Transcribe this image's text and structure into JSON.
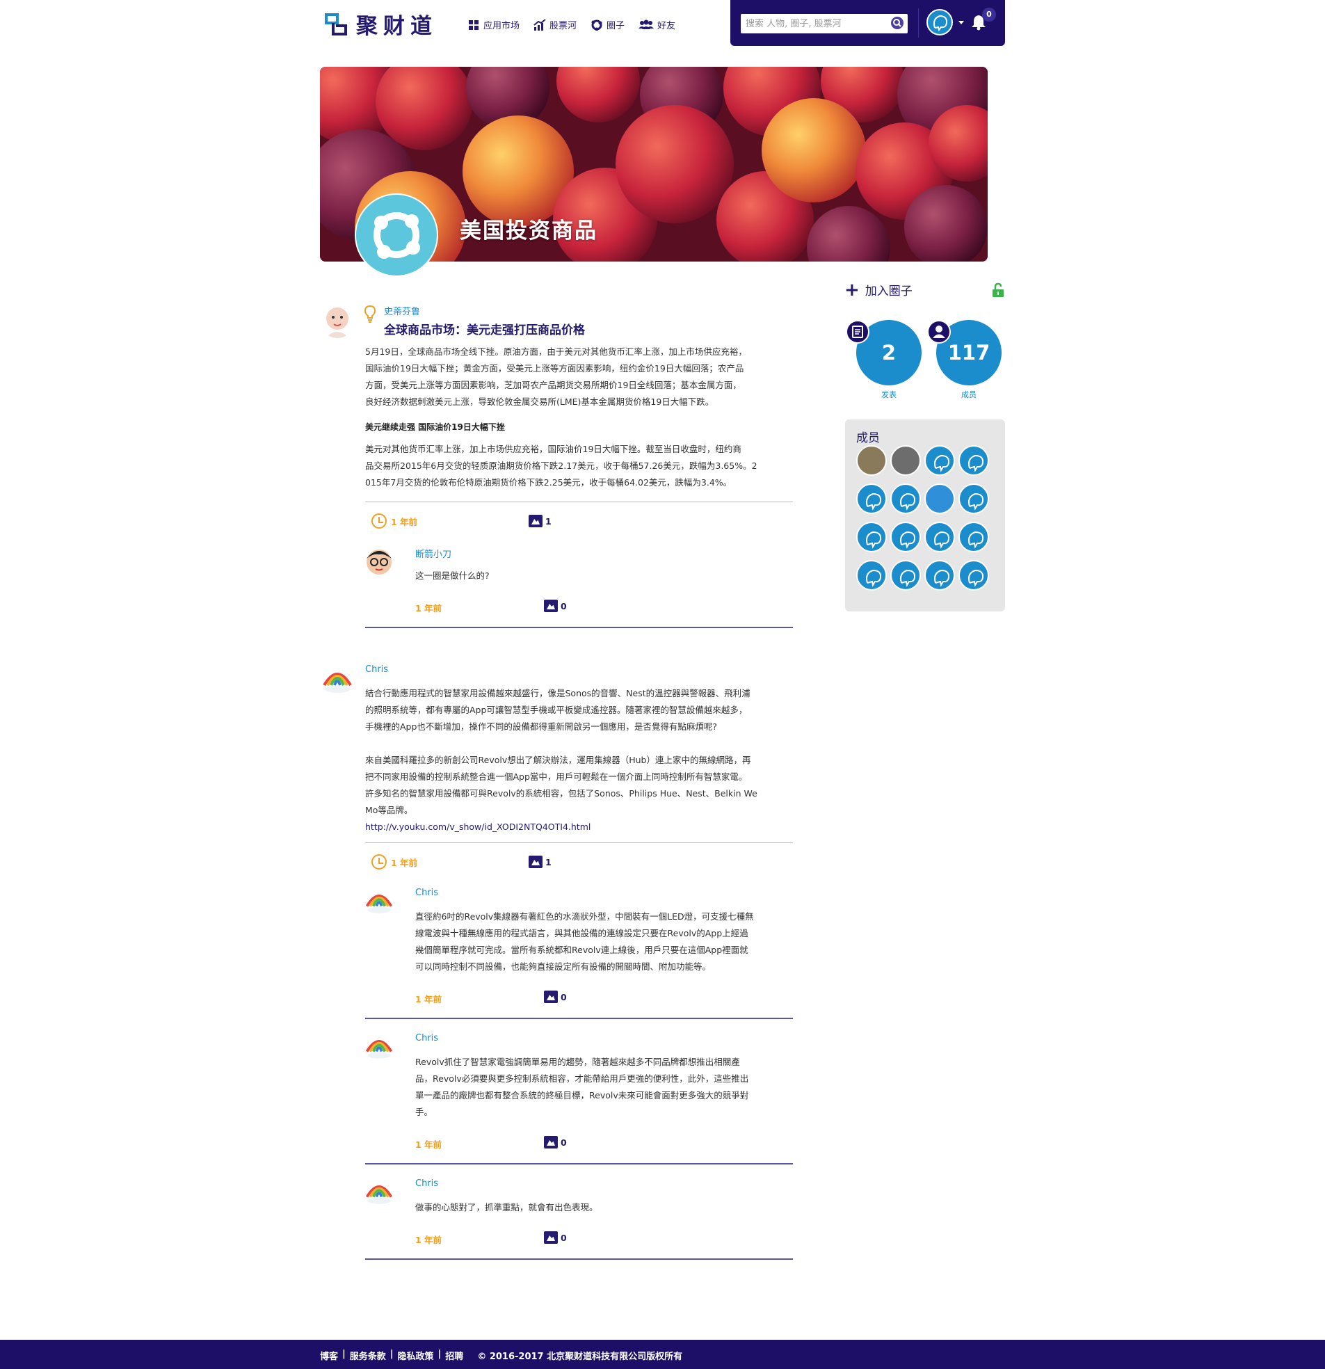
{
  "header": {
    "logo_text": "聚财道",
    "nav": [
      {
        "label": "应用市场",
        "icon": "grid-icon"
      },
      {
        "label": "股票河",
        "icon": "chart-icon"
      },
      {
        "label": "圈子",
        "icon": "circle-icon"
      },
      {
        "label": "好友",
        "icon": "friends-icon"
      }
    ],
    "search_placeholder": "搜索 人物, 圈子, 股票河",
    "notification_count": "0"
  },
  "banner": {
    "group_name": "美国投资商品"
  },
  "sidebar": {
    "join_label": "加入圈子",
    "stats": [
      {
        "value": "2",
        "label": "发表"
      },
      {
        "value": "117",
        "label": "成员"
      }
    ],
    "members_title": "成员"
  },
  "posts": [
    {
      "author": "史蒂芬鲁",
      "title": "全球商品市场：美元走强打压商品价格",
      "paragraphs": [
        "5月19日，全球商品市场全线下挫。原油方面，由于美元对其他货币汇率上涨，加上市场供应充裕，",
        "国际油价19日大幅下挫；黄金方面，受美元上涨等方面因素影响，纽约金价19日大幅回落；农产品",
        "方面，受美元上涨等方面因素影响，芝加哥农产品期货交易所期价19日全线回落；基本金属方面，",
        "良好经济数据刺激美元上涨，导致伦敦金属交易所(LME)基本金属期货价格19日大幅下跌。"
      ],
      "subheading": "美元继续走强 国际油价19日大幅下挫",
      "paragraphs2": [
        "美元对其他货币汇率上涨，加上市场供应充裕，国际油价19日大幅下挫。截至当日收盘时，纽约商",
        "品交易所2015年6月交货的轻质原油期货价格下跌2.17美元，收于每桶57.26美元，跌幅为3.65%。2",
        "015年7月交货的伦敦布伦特原油期货价格下跌2.25美元，收于每桶64.02美元，跌幅为3.4%。"
      ],
      "time": "1 年前",
      "comment_count": "1",
      "comments": [
        {
          "author": "断箭小刀",
          "lines": [
            "这一圈是做什么的?"
          ],
          "time": "1 年前",
          "count": "0"
        }
      ]
    },
    {
      "author": "Chris",
      "paragraphs": [
        "結合行動應用程式的智慧家用設備越來越盛行，像是Sonos的音響、Nest的溫控器與警報器、飛利浦",
        "的照明系統等，都有專屬的App可讓智慧型手機或平板變成遙控器。隨著家裡的智慧設備越來越多，",
        "手機裡的App也不斷增加，操作不同的設備都得重新開啟另一個應用，是否覺得有點麻煩呢?"
      ],
      "paragraphs2": [
        "來自美國科羅拉多的新創公司Revolv想出了解決辦法，運用集線器（Hub）連上家中的無線網路，再",
        "把不同家用設備的控制系統整合進一個App當中，用戶可輕鬆在一個介面上同時控制所有智慧家電。",
        "許多知名的智慧家用設備都可與Revolv的系統相容，包括了Sonos、Philips Hue、Nest、Belkin We",
        "Mo等品牌。"
      ],
      "link": "http://v.youku.com/v_show/id_XODI2NTQ4OTI4.html",
      "time": "1 年前",
      "comment_count": "1",
      "comments": [
        {
          "author": "Chris",
          "lines": [
            "直徑約6吋的Revolv集線器有著紅色的水滴狀外型，中間裝有一個LED燈，可支援七種無",
            "線電波與十種無線應用的程式語言，與其他設備的連線設定只要在Revolv的App上經過",
            "幾個簡單程序就可完成。當所有系統都和Revolv連上線後，用戶只要在這個App裡面就",
            "可以同時控制不同設備，也能夠直接設定所有設備的開關時間、附加功能等。"
          ],
          "time": "1 年前",
          "count": "0"
        },
        {
          "author": "Chris",
          "lines": [
            "Revolv抓住了智慧家電強調簡單易用的趨勢，隨著越來越多不同品牌都想推出相關產",
            "品，Revolv必須要與更多控制系統相容，才能帶給用戶更強的便利性，此外，這些推出",
            "單一產品的廠牌也都有整合系統的終極目標，Revolv未來可能會面對更多強大的競爭對",
            "手。"
          ],
          "time": "1 年前",
          "count": "0"
        },
        {
          "author": "Chris",
          "lines": [
            "做事的心態對了，抓準重點，就會有出色表現。"
          ],
          "time": "1 年前",
          "count": "0"
        }
      ]
    }
  ],
  "footer": {
    "links": [
      "博客",
      "服务条款",
      "隐私政策",
      "招聘"
    ],
    "copyright": "© 2016-2017 北京聚财道科技有限公司版权所有"
  },
  "colors": {
    "brand": "#1d0f68",
    "accent": "#1b8ccc",
    "time": "#f0a020"
  }
}
